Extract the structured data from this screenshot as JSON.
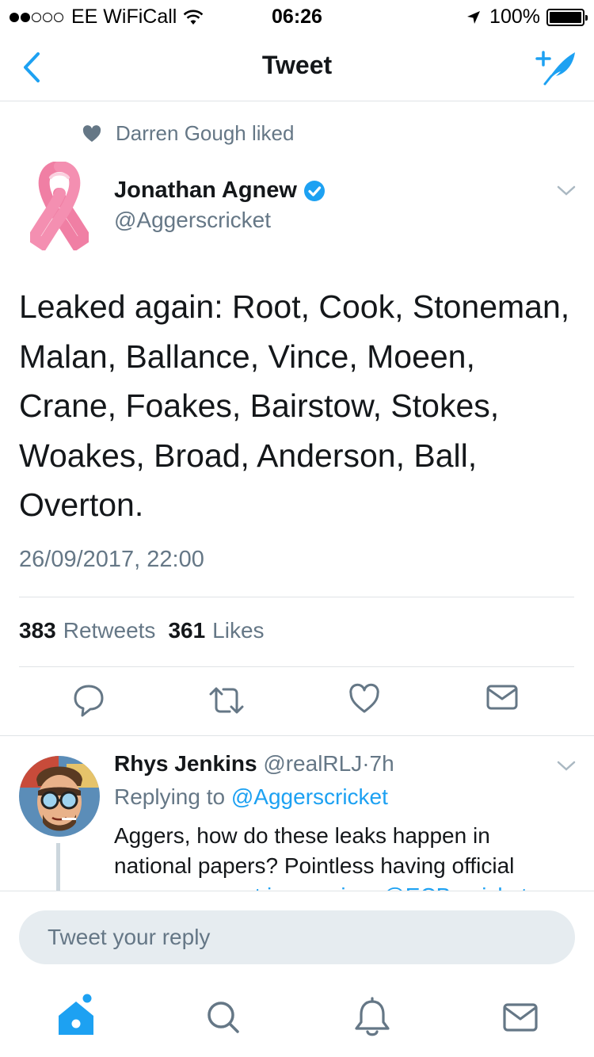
{
  "status_bar": {
    "carrier": "EE WiFiCall",
    "time": "06:26",
    "battery": "100%"
  },
  "nav": {
    "title": "Tweet"
  },
  "social_context": {
    "text": "Darren Gough liked"
  },
  "tweet": {
    "author_name": "Jonathan Agnew",
    "author_handle": "@Aggerscricket",
    "text": "Leaked again: Root, Cook, Stoneman, Malan, Ballance, Vince, Moeen, Crane, Foakes, Bairstow, Stokes, Woakes, Broad, Anderson, Ball, Overton.",
    "date": "26/09/2017, 22:00",
    "retweets_count": "383",
    "retweets_label": "Retweets",
    "likes_count": "361",
    "likes_label": "Likes"
  },
  "reply": {
    "name": "Rhys Jenkins",
    "handle": "@realRLJ",
    "separator": "·",
    "age": "7h",
    "replying_prefix": "Replying to",
    "replying_to": "@Aggerscricket",
    "text_line1": "Aggers, how do these leaks happen in",
    "text_line2": "national papers? Pointless having official",
    "text_line3_cut": "announcement in morning. @ECB_cricket"
  },
  "composer": {
    "placeholder": "Tweet your reply"
  },
  "colors": {
    "accent": "#1da1f2",
    "secondary_text": "#657786",
    "divider": "#dfe3e6",
    "ribbon": "#f07fa4"
  },
  "icons": {
    "back": "chevron-left-icon",
    "compose": "compose-feather-icon",
    "liked": "heart-filled-icon",
    "verified": "verified-badge-icon",
    "more": "chevron-down-icon",
    "reply": "reply-bubble-icon",
    "retweet": "retweet-icon",
    "like": "heart-outline-icon",
    "dm": "envelope-icon",
    "home": "home-icon",
    "search": "search-icon",
    "notifications": "bell-icon",
    "messages": "envelope-icon"
  }
}
